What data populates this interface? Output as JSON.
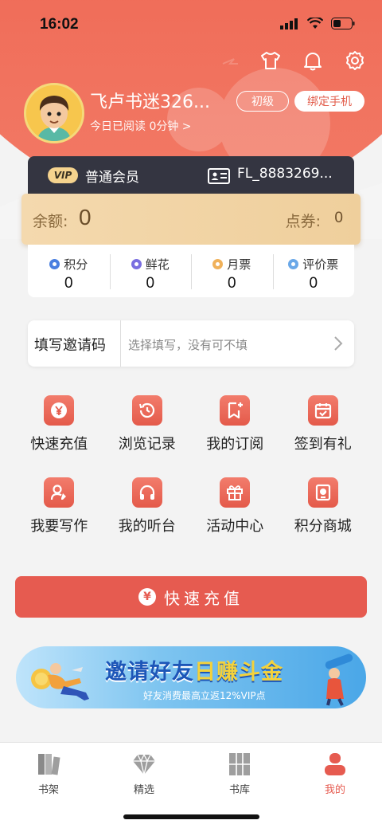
{
  "status_bar": {
    "time": "16:02"
  },
  "profile": {
    "username": "飞卢书迷326...",
    "read_today": "今日已阅读 0分钟 >",
    "level": "初级",
    "bind_phone": "绑定手机"
  },
  "vip": {
    "badge": "VIP",
    "level": "普通会员",
    "user_id": "FL_8883269..."
  },
  "balance": {
    "label": "余额:",
    "value": "0",
    "coupon_label": "点券:",
    "coupon_value": "0"
  },
  "stats": [
    {
      "label": "积分",
      "value": "0",
      "color": "#4a7fe0"
    },
    {
      "label": "鲜花",
      "value": "0",
      "color": "#7a6ee0"
    },
    {
      "label": "月票",
      "value": "0",
      "color": "#f0b15a"
    },
    {
      "label": "评价票",
      "value": "0",
      "color": "#6aa8e8"
    }
  ],
  "invite": {
    "label": "填写邀请码",
    "placeholder": "选择填写，没有可不填"
  },
  "grid": [
    {
      "label": "快速充值",
      "icon": "yen-icon"
    },
    {
      "label": "浏览记录",
      "icon": "history-icon"
    },
    {
      "label": "我的订阅",
      "icon": "bookmark-add-icon"
    },
    {
      "label": "签到有礼",
      "icon": "calendar-check-icon"
    },
    {
      "label": "我要写作",
      "icon": "writer-icon"
    },
    {
      "label": "我的听台",
      "icon": "headphones-icon"
    },
    {
      "label": "活动中心",
      "icon": "gift-icon"
    },
    {
      "label": "积分商城",
      "icon": "shop-icon"
    }
  ],
  "recharge_button": {
    "icon": "¥",
    "label": "快速充值"
  },
  "banner": {
    "title_part1": "邀请好友",
    "title_part2": "日赚斗金",
    "subtitle": "好友消费最高立返12%VIP点"
  },
  "tabs": [
    {
      "label": "书架",
      "icon": "bookshelf-icon",
      "active": false
    },
    {
      "label": "精选",
      "icon": "diamond-icon",
      "active": false
    },
    {
      "label": "书库",
      "icon": "library-icon",
      "active": false
    },
    {
      "label": "我的",
      "icon": "profile-icon",
      "active": true
    }
  ],
  "colors": {
    "header_red": "#ef5e4e",
    "accent": "#e65b50",
    "vip_dark": "#343541",
    "gold": "#efcf9c"
  }
}
